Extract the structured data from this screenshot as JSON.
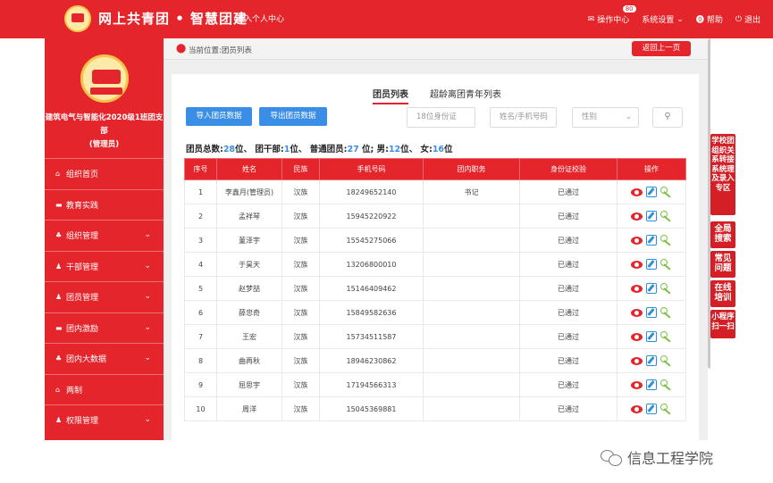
{
  "header": {
    "site_title": "网上共青团 • 智慧团建",
    "personal_center": "进入个人中心",
    "nav": [
      {
        "icon": "mail-icon",
        "label": "操作中心",
        "badge": "80"
      },
      {
        "icon": "settings-icon",
        "label": "系统设置"
      },
      {
        "icon": "help-icon",
        "label": "帮助"
      },
      {
        "icon": "power-icon",
        "label": "退出"
      }
    ]
  },
  "sidebar": {
    "org_line1": "建筑电气与智能化2020级1班团支",
    "org_line2": "部",
    "org_line3": "(管理员)",
    "items": [
      {
        "label": "组织首页",
        "icon": "home-icon",
        "expandable": false
      },
      {
        "label": "教育实践",
        "icon": "folder-icon",
        "expandable": false
      },
      {
        "label": "组织管理",
        "icon": "sitemap-icon",
        "expandable": true
      },
      {
        "label": "干部管理",
        "icon": "users-icon",
        "expandable": true
      },
      {
        "label": "团员管理",
        "icon": "users-icon",
        "expandable": true
      },
      {
        "label": "团内激励",
        "icon": "folder-icon",
        "expandable": true
      },
      {
        "label": "团内大数据",
        "icon": "sitemap-icon",
        "expandable": true
      },
      {
        "label": "两制",
        "icon": "home-icon",
        "expandable": false
      },
      {
        "label": "权限管理",
        "icon": "users-icon",
        "expandable": true
      }
    ]
  },
  "breadcrumb": {
    "text": "当前位置:团员列表",
    "back_label": "返回上一页"
  },
  "main": {
    "tabs": [
      "团员列表",
      "超龄离团青年列表"
    ],
    "active_tab": 0,
    "import_label": "导入团员数据",
    "export_label": "导出团员数据",
    "id_placeholder": "18位身份证",
    "name_placeholder": "姓名/手机号码",
    "gender_placeholder": "性别",
    "stats": {
      "total_label": "团员总数:",
      "total": "28",
      "cadre_label": "团干部:",
      "cadre": "1",
      "regular_label": "普通团员:",
      "regular": "27",
      "male_label": "男:",
      "male": "12",
      "female_label": "女:",
      "female": "16",
      "unit": "位"
    },
    "table": {
      "headers": [
        "序号",
        "姓名",
        "民族",
        "手机号码",
        "团内职务",
        "身份证校验",
        "操作"
      ],
      "rows": [
        [
          "1",
          "李鑫月(管理员)",
          "汉族",
          "18249652140",
          "书记",
          "已通过"
        ],
        [
          "2",
          "孟祥琴",
          "汉族",
          "15945220922",
          "",
          "已通过"
        ],
        [
          "3",
          "菫泽宇",
          "汉族",
          "15545275066",
          "",
          "已通过"
        ],
        [
          "4",
          "于昊天",
          "汉族",
          "13206800010",
          "",
          "已通过"
        ],
        [
          "5",
          "赵梦喆",
          "汉族",
          "15146409462",
          "",
          "已通过"
        ],
        [
          "6",
          "薛忠奇",
          "汉族",
          "15849582636",
          "",
          "已通过"
        ],
        [
          "7",
          "王宏",
          "汉族",
          "15734511587",
          "",
          "已通过"
        ],
        [
          "8",
          "曲再秋",
          "汉族",
          "18946230862",
          "",
          "已通过"
        ],
        [
          "9",
          "屈思宇",
          "汉族",
          "17194566313",
          "",
          "已通过"
        ],
        [
          "10",
          "周洋",
          "汉族",
          "15045369881",
          "",
          "已通过"
        ]
      ]
    }
  },
  "right_panel": {
    "buttons": [
      "学校团组织关系转接系统理及录入专区",
      "全局搜索",
      "常见问题",
      "在线培训",
      "小程序扫一扫"
    ]
  },
  "watermark": "信息工程学院",
  "colors": {
    "brand_red": "#e4252b",
    "accent_blue": "#3a8ee6",
    "link_green": "#7bc142"
  }
}
